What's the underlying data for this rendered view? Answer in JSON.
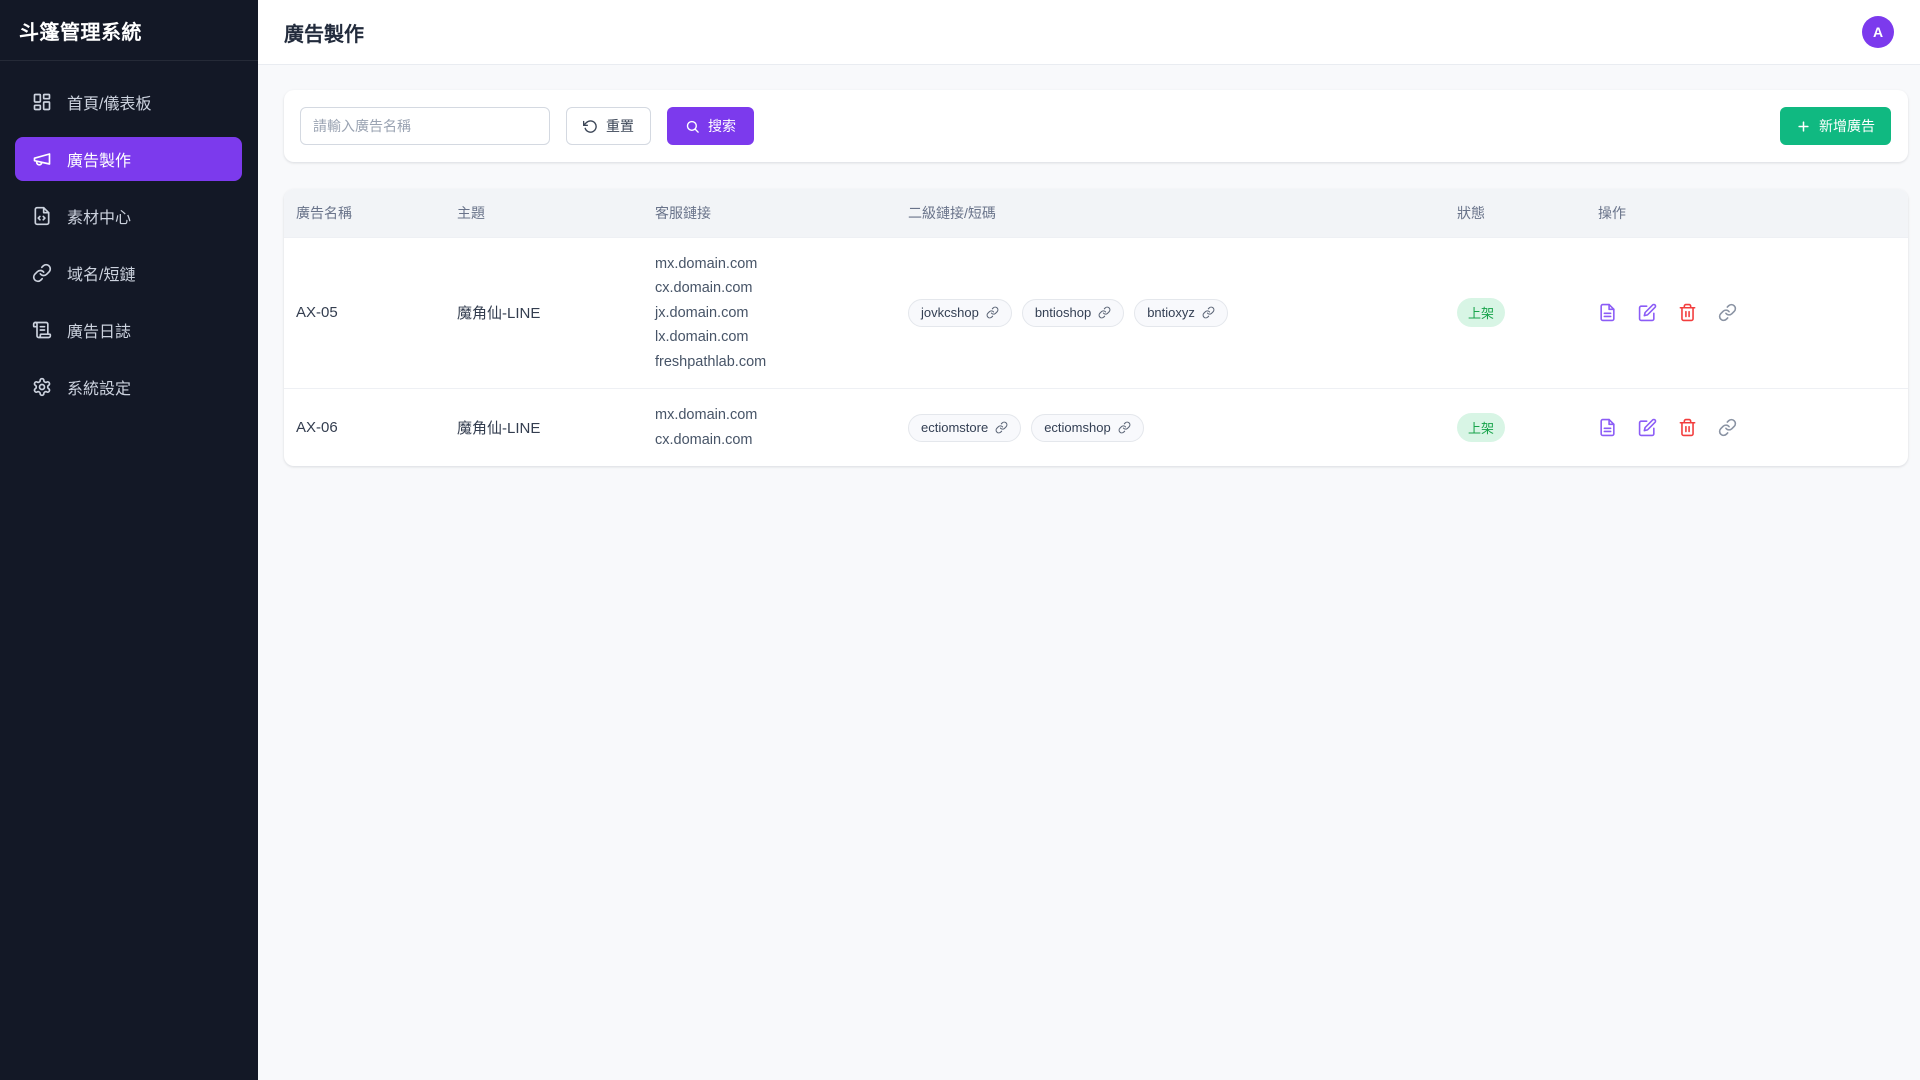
{
  "colors": {
    "accent_purple": "#7c3aed",
    "success_green": "#10b981",
    "danger_red": "#f23d3d",
    "sidebar_bg": "#131826",
    "status_badge_bg": "#d8f5e5",
    "status_badge_text": "#17a34a",
    "main_bg": "#f8f9fb"
  },
  "sidebar": {
    "title": "斗篷管理系統",
    "items": [
      {
        "label": "首頁/儀表板",
        "icon": "dashboard-icon",
        "active": false
      },
      {
        "label": "廣告製作",
        "icon": "megaphone-icon",
        "active": true
      },
      {
        "label": "素材中心",
        "icon": "file-code-icon",
        "active": false
      },
      {
        "label": "域名/短鏈",
        "icon": "link-icon",
        "active": false
      },
      {
        "label": "廣告日誌",
        "icon": "scroll-icon",
        "active": false
      },
      {
        "label": "系統設定",
        "icon": "gear-icon",
        "active": false
      }
    ]
  },
  "header": {
    "title": "廣告製作",
    "avatar_initial": "A"
  },
  "filter": {
    "search_placeholder": "請輸入廣告名稱",
    "search_value": "",
    "reset_label": "重置",
    "search_label": "搜索",
    "add_label": "新增廣告"
  },
  "table": {
    "columns": [
      "廣告名稱",
      "主題",
      "客服鏈接",
      "二級鏈接/短碼",
      "狀態",
      "操作"
    ],
    "rows": [
      {
        "name": "AX-05",
        "topic": "魔角仙-LINE",
        "service_links": [
          "mx.domain.com",
          "cx.domain.com",
          "jx.domain.com",
          "lx.domain.com",
          "freshpathlab.com"
        ],
        "short_codes": [
          "jovkcshop",
          "bntioshop",
          "bntioxyz"
        ],
        "status": "上架"
      },
      {
        "name": "AX-06",
        "topic": "魔角仙-LINE",
        "service_links": [
          "mx.domain.com",
          "cx.domain.com"
        ],
        "short_codes": [
          "ectiomstore",
          "ectiomshop"
        ],
        "status": "上架"
      }
    ]
  }
}
